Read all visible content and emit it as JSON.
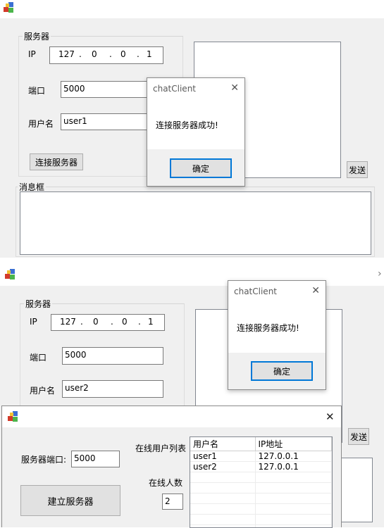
{
  "window1": {
    "server_group": "服务器",
    "ip_label": "IP",
    "ip_octets": [
      "127",
      "0",
      "0",
      "1"
    ],
    "port_label": "端口",
    "port_value": "5000",
    "username_label": "用户名",
    "username_value": "user1",
    "connect_button": "连接服务器",
    "send_button": "发送",
    "message_group": "消息框",
    "dialog": {
      "title": "chatClient",
      "message": "连接服务器成功!",
      "ok_button": "确定"
    }
  },
  "window2": {
    "server_group": "服务器",
    "ip_label": "IP",
    "ip_octets": [
      "127",
      "0",
      "0",
      "1"
    ],
    "port_label": "端口",
    "port_value": "5000",
    "username_label": "用户名",
    "username_value": "user2",
    "send_button": "发送",
    "dialog": {
      "title": "chatClient",
      "message": "连接服务器成功!",
      "ok_button": "确定"
    }
  },
  "server_window": {
    "port_label": "服务器端口:",
    "port_value": "5000",
    "start_button": "建立服务器",
    "online_list_label": "在线用户列表",
    "online_count_label": "在线人数",
    "online_count": "2",
    "columns": [
      "用户名",
      "IP地址"
    ],
    "rows": [
      {
        "user": "user1",
        "ip": "127.0.0.1"
      },
      {
        "user": "user2",
        "ip": "127.0.0.1"
      }
    ]
  },
  "icons": {
    "app_icon": "app-icon",
    "close": "close-icon",
    "chevron": "chevron-right-icon"
  }
}
